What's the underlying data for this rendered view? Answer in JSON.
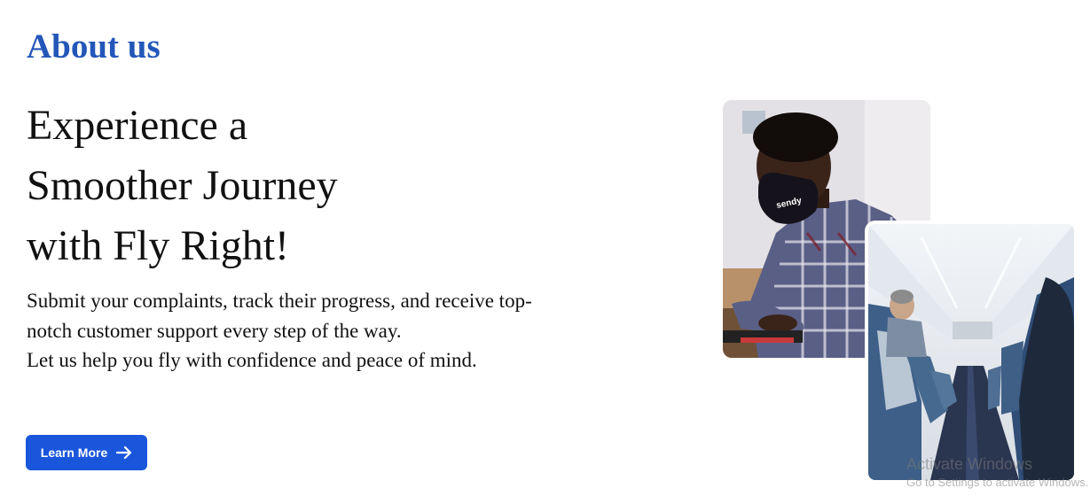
{
  "about": {
    "title": "About us",
    "headline_lines": [
      "Experience a",
      "Smoother Journey",
      "with Fly Right!"
    ],
    "description_lines": [
      "Submit your complaints, track their progress, and receive top-notch customer support every step of the way.",
      "Let us help you fly with confidence and peace of mind."
    ],
    "button_label": "Learn More",
    "button_icon": "arrow-right-icon"
  },
  "images": {
    "work_photo_mask_text": "sendy"
  },
  "watermark": {
    "title": "Activate Windows",
    "subtitle": "Go to Settings to activate Windows."
  },
  "colors": {
    "title_blue": "#2356b8",
    "button_blue": "#1a56db"
  }
}
